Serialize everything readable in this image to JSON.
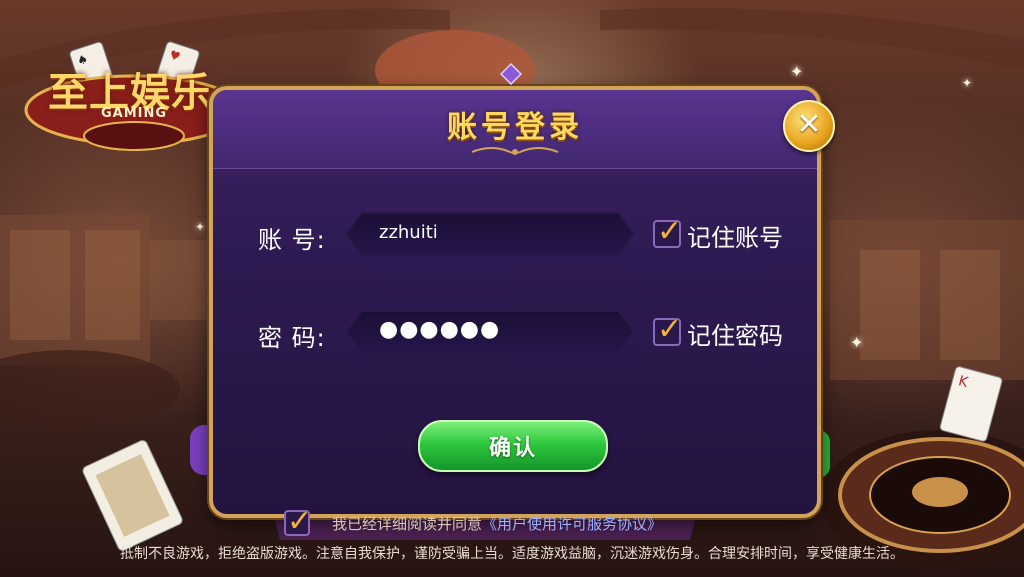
{
  "logo": {
    "title": "至上娱乐",
    "subtitle": "GAMING"
  },
  "dialog": {
    "title": "账号登录",
    "account": {
      "label": "账 号:",
      "value": "zzhuiti",
      "remember_label": "记住账号",
      "remember_checked": true
    },
    "password": {
      "label": "密 码:",
      "value": "●●●●●●",
      "remember_label": "记住密码",
      "remember_checked": true
    },
    "confirm_label": "确认",
    "close_icon": "close-icon"
  },
  "agreement": {
    "checked": true,
    "prefix": "我已经详细阅读并同意",
    "link": "《用户使用许可服务协议》"
  },
  "footer": "抵制不良游戏，拒绝盗版游戏。注意自我保护，谨防受骗上当。适度游戏益脑，沉迷游戏伤身。合理安排时间，享受健康生活。",
  "colors": {
    "accent_gold": "#ffd860",
    "dialog_purple": "#2e1a52",
    "confirm_green": "#2fc83e",
    "link_blue": "#9fb0ff"
  }
}
